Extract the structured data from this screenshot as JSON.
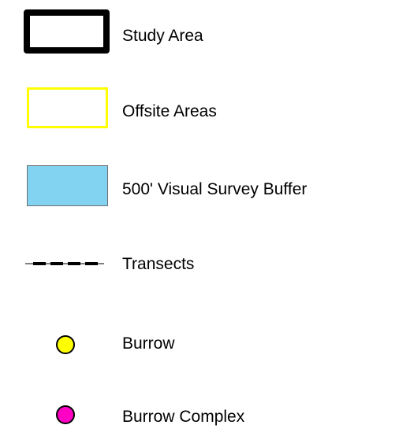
{
  "legend": {
    "items": [
      {
        "label": "Study Area",
        "symbol": "black-outlined-rectangle",
        "fill": "#ffffff",
        "stroke": "#000000"
      },
      {
        "label": "Offsite Areas",
        "symbol": "yellow-outlined-rectangle",
        "fill": "#ffffff",
        "stroke": "#ffff00"
      },
      {
        "label": "500' Visual Survey Buffer",
        "symbol": "light-blue-filled-rectangle",
        "fill": "#82d3f2",
        "stroke": "#6e6e6e"
      },
      {
        "label": "Transects",
        "symbol": "dashed-line",
        "stroke": "#000000"
      },
      {
        "label": "Burrow",
        "symbol": "yellow-circle",
        "fill": "#ffff00",
        "stroke": "#000000"
      },
      {
        "label": "Burrow Complex",
        "symbol": "magenta-circle",
        "fill": "#ff00c5",
        "stroke": "#000000"
      }
    ]
  }
}
